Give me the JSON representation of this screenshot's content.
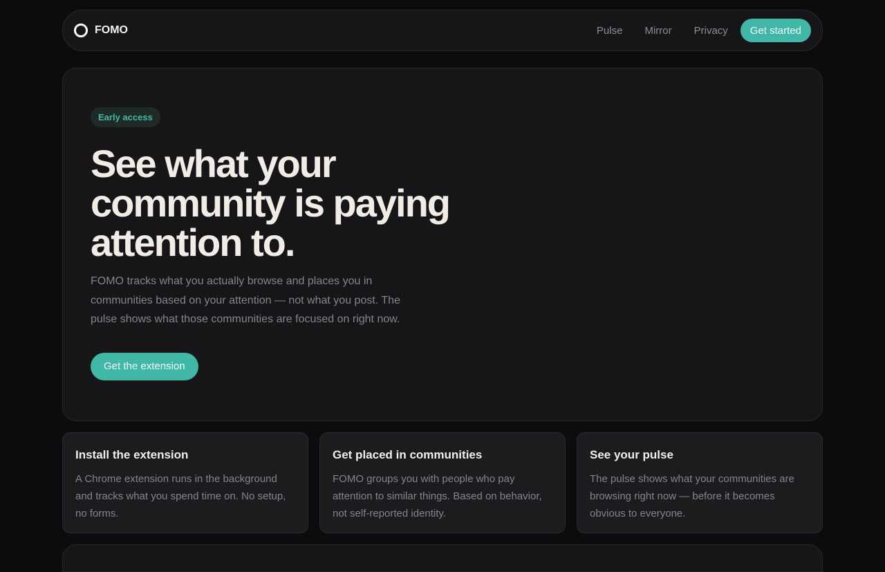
{
  "nav": {
    "brand": "FOMO",
    "links": [
      "Pulse",
      "Mirror",
      "Privacy"
    ],
    "cta": "Get started"
  },
  "hero": {
    "badge": "Early access",
    "title": "See what your community is paying attention to.",
    "description": "FOMO tracks what you actually browse and places you in communities based on your attention — not what you post. The pulse shows what those communities are focused on right now.",
    "cta": "Get the extension"
  },
  "cards": [
    {
      "title": "Install the extension",
      "body": "A Chrome extension runs in the background and tracks what you spend time on. No setup, no forms."
    },
    {
      "title": "Get placed in communities",
      "body": "FOMO groups you with people who pay attention to similar things. Based on behavior, not self-reported identity."
    },
    {
      "title": "See your pulse",
      "body": "The pulse shows what your communities are browsing right now — before it becomes obvious to everyone."
    }
  ],
  "colors": {
    "accent": "#3fb8a8",
    "background": "#0c0c0e",
    "panel": "#161618"
  }
}
